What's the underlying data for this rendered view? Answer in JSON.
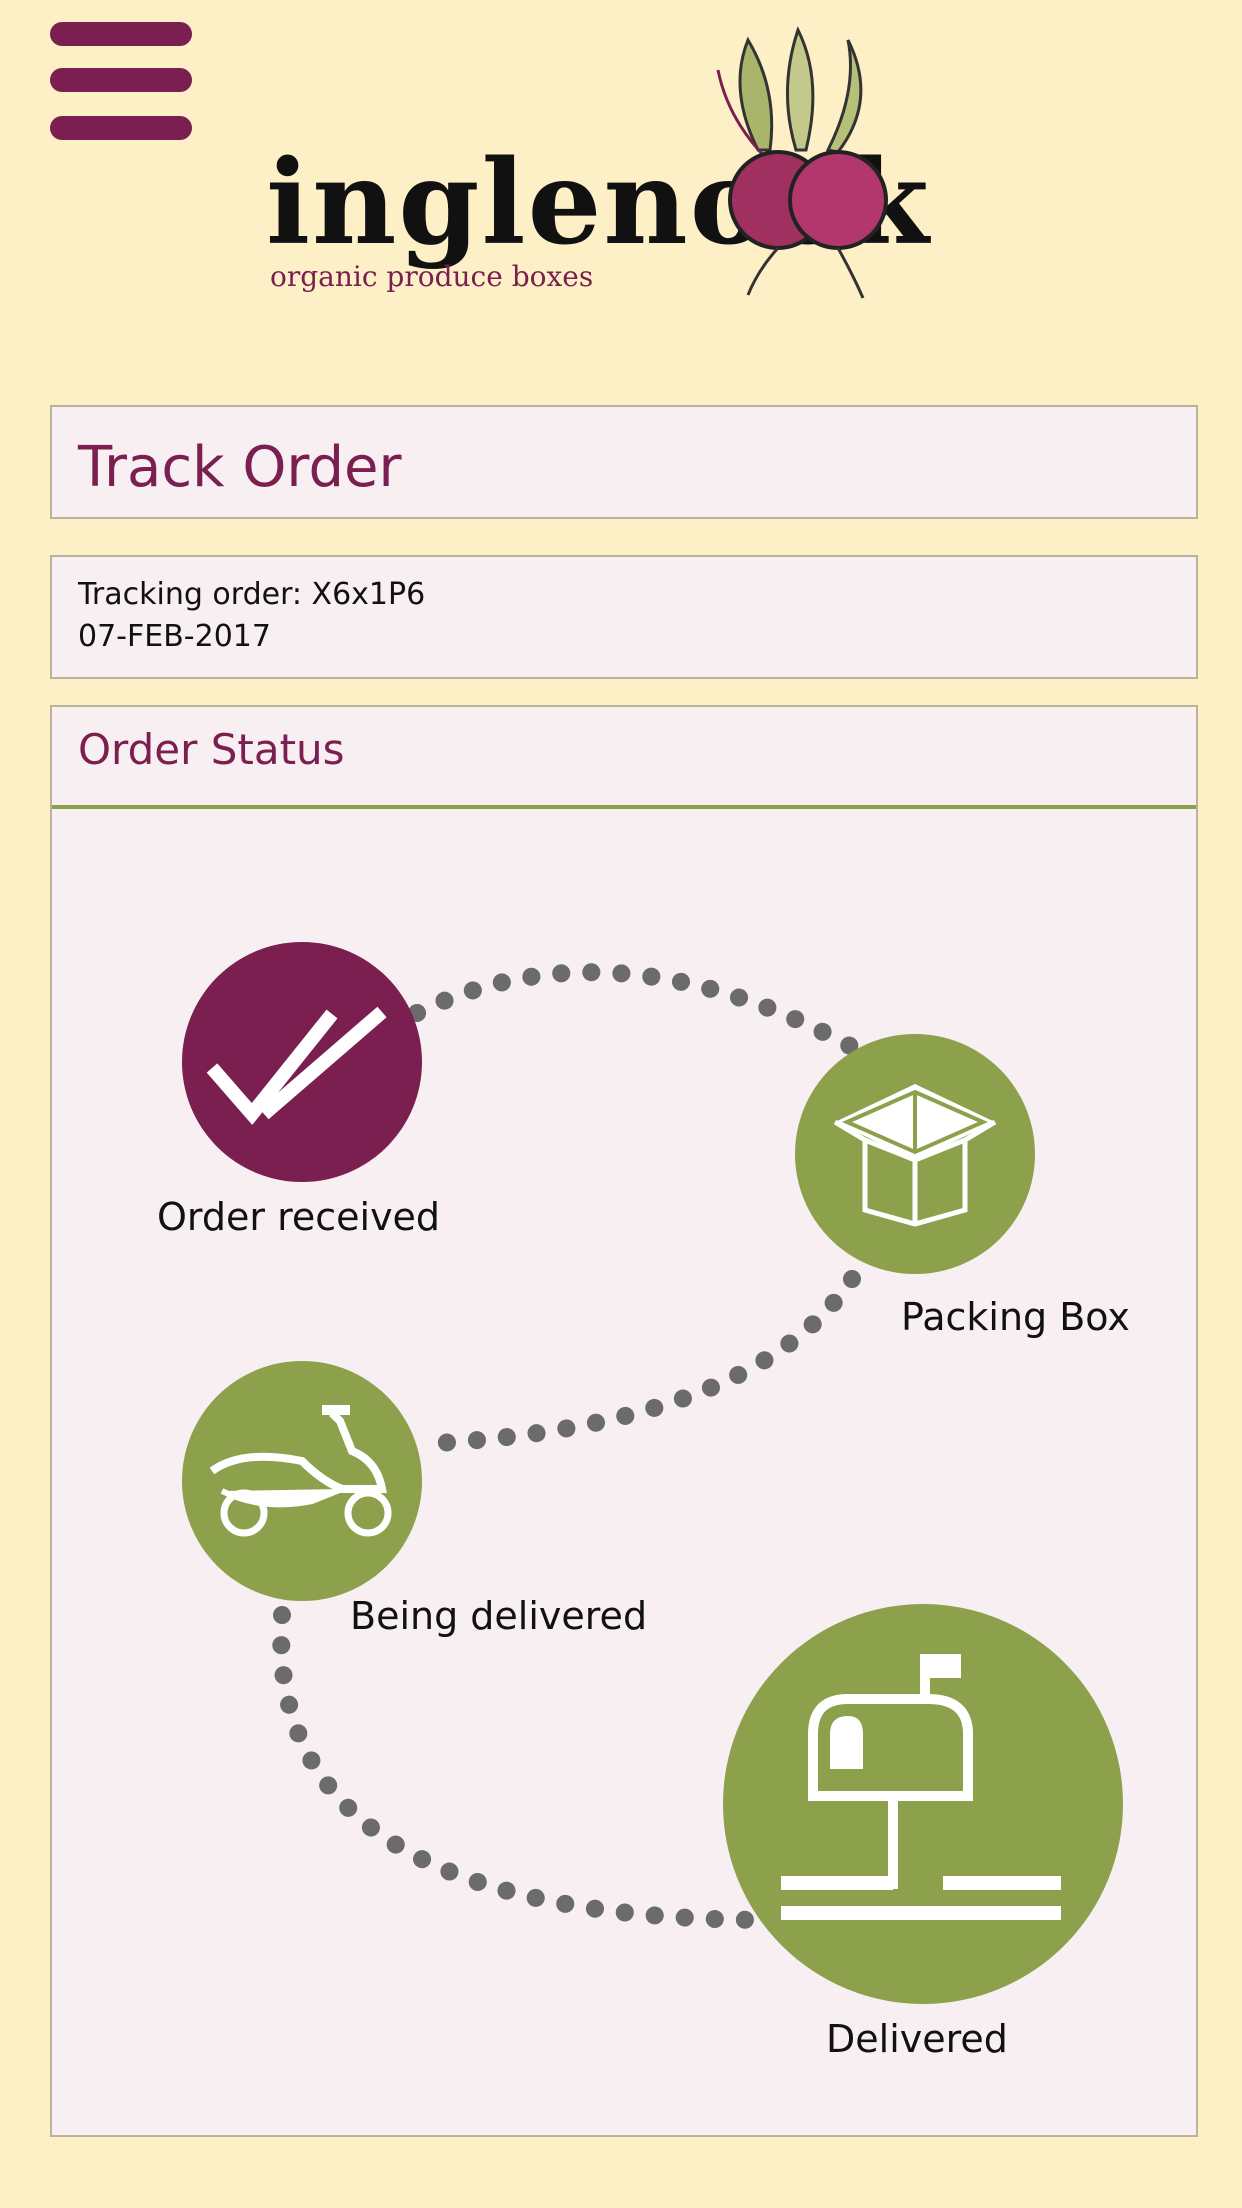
{
  "header": {
    "menu_icon": "hamburger-menu-icon",
    "logo_text": "inglenook",
    "logo_tagline": "organic produce boxes"
  },
  "page": {
    "title": "Track Order"
  },
  "tracking": {
    "order_line": "Tracking order: X6x1P6",
    "date": "07-FEB-2017"
  },
  "status": {
    "heading": "Order Status",
    "steps": [
      {
        "label": "Order received",
        "icon": "double-check-icon",
        "state": "complete",
        "color": "#7b1e50"
      },
      {
        "label": "Packing Box",
        "icon": "open-box-icon",
        "state": "pending",
        "color": "#8da04b"
      },
      {
        "label": "Being delivered",
        "icon": "scooter-icon",
        "state": "pending",
        "color": "#8da04b"
      },
      {
        "label": "Delivered",
        "icon": "mailbox-icon",
        "state": "pending",
        "color": "#8da04b"
      }
    ]
  },
  "colors": {
    "background": "#fdefc6",
    "brand": "#7b1e50",
    "accent": "#8da04b",
    "panel": "#f7eff2",
    "path_dots": "#6b6b6b"
  }
}
